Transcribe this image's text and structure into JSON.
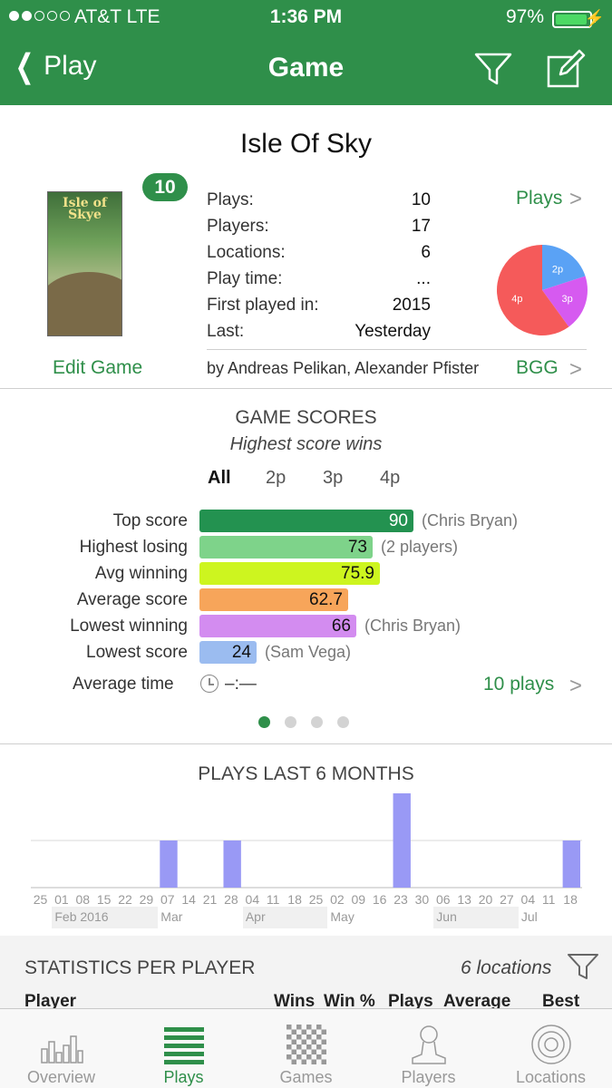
{
  "status_bar": {
    "carrier": "AT&T  LTE",
    "time": "1:36 PM",
    "battery": "97%"
  },
  "nav": {
    "back_label": "Play",
    "title": "Game"
  },
  "game": {
    "title": "Isle Of Sky",
    "cover_text": "Isle of Skye",
    "badge": "10",
    "edit_label": "Edit Game",
    "stats": [
      {
        "label": "Plays:",
        "value": "10"
      },
      {
        "label": "Players:",
        "value": "17"
      },
      {
        "label": "Locations:",
        "value": "6"
      },
      {
        "label": "Play time:",
        "value": "..."
      },
      {
        "label": "First played in:",
        "value": "2015"
      },
      {
        "label": "Last:",
        "value": "Yesterday"
      }
    ],
    "plays_link": "Plays",
    "authors": "by Andreas Pelikan, Alexander Pfister",
    "bgg_link": "BGG",
    "pie": [
      {
        "label": "2p",
        "value": 2,
        "color": "#5aa2f5"
      },
      {
        "label": "3p",
        "value": 2,
        "color": "#d65af0"
      },
      {
        "label": "4p",
        "value": 6,
        "color": "#f55a5a"
      }
    ]
  },
  "scores": {
    "title": "GAME SCORES",
    "subtitle": "Highest score wins",
    "tabs": [
      "All",
      "2p",
      "3p",
      "4p"
    ],
    "active_tab": "All",
    "rows": [
      {
        "label": "Top score",
        "value": "90",
        "num": 90,
        "note": "(Chris Bryan)",
        "color": "#239250",
        "text_color": "#ffffff"
      },
      {
        "label": "Highest losing",
        "value": "73",
        "num": 73,
        "note": "(2 players)",
        "color": "#7ed38a",
        "text_color": "#111111"
      },
      {
        "label": "Avg winning",
        "value": "75.9",
        "num": 75.9,
        "note": "",
        "color": "#cdf51f",
        "text_color": "#111111"
      },
      {
        "label": "Average score",
        "value": "62.7",
        "num": 62.7,
        "note": "",
        "color": "#f7a55a",
        "text_color": "#111111"
      },
      {
        "label": "Lowest winning",
        "value": "66",
        "num": 66,
        "note": "(Chris Bryan)",
        "color": "#d38cf0",
        "text_color": "#111111"
      },
      {
        "label": "Lowest score",
        "value": "24",
        "num": 24,
        "note": "(Sam Vega)",
        "color": "#9bbcf0",
        "text_color": "#111111"
      }
    ],
    "avg_time_label": "Average time",
    "avg_time_value": "–:—",
    "plays_link": "10 plays"
  },
  "chart_data": {
    "type": "bar",
    "title": "PLAYS LAST 6 MONTHS",
    "categories": [
      "25",
      "01",
      "08",
      "15",
      "22",
      "29",
      "07",
      "14",
      "21",
      "28",
      "04",
      "11",
      "18",
      "25",
      "02",
      "09",
      "16",
      "23",
      "30",
      "06",
      "13",
      "20",
      "27",
      "04",
      "11",
      "18"
    ],
    "values": [
      0,
      0,
      0,
      0,
      0,
      0,
      1,
      0,
      0,
      1,
      0,
      0,
      0,
      0,
      0,
      0,
      0,
      2,
      0,
      0,
      0,
      0,
      0,
      0,
      0,
      1
    ],
    "months": [
      "Feb 2016",
      "Mar",
      "Apr",
      "May",
      "Jun",
      "Jul"
    ],
    "ylim": [
      0,
      2
    ],
    "bar_color": "#9999f5"
  },
  "player_stats": {
    "title": "STATISTICS PER PLAYER",
    "locations": "6 locations",
    "columns": [
      "Player",
      "Wins",
      "Win %",
      "Plays",
      "Average",
      "Best"
    ]
  },
  "tabbar": [
    {
      "label": "Overview",
      "icon": "bar-chart-icon"
    },
    {
      "label": "Plays",
      "icon": "list-icon"
    },
    {
      "label": "Games",
      "icon": "checkerboard-icon"
    },
    {
      "label": "Players",
      "icon": "person-icon"
    },
    {
      "label": "Locations",
      "icon": "target-icon"
    }
  ],
  "active_tab": "Plays"
}
